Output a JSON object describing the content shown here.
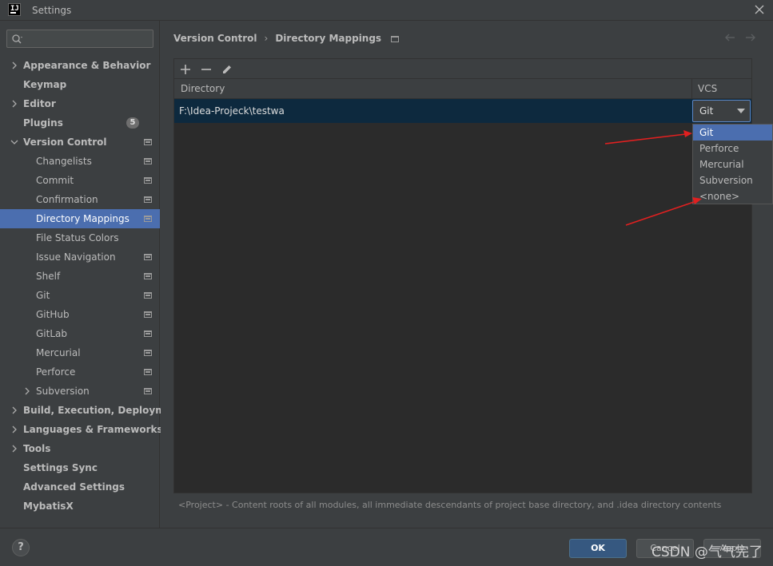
{
  "window": {
    "title": "Settings"
  },
  "search": {
    "placeholder": ""
  },
  "sidebar": {
    "items": [
      {
        "label": "Appearance & Behavior",
        "level": 1,
        "bold": true,
        "chevron": "right"
      },
      {
        "label": "Keymap",
        "level": 1,
        "bold": true
      },
      {
        "label": "Editor",
        "level": 1,
        "bold": true,
        "chevron": "right"
      },
      {
        "label": "Plugins",
        "level": 1,
        "bold": true,
        "badge": "5"
      },
      {
        "label": "Version Control",
        "level": 1,
        "bold": true,
        "chevron": "down",
        "project_icon": true
      },
      {
        "label": "Changelists",
        "level": 2,
        "project_icon": true
      },
      {
        "label": "Commit",
        "level": 2,
        "project_icon": true
      },
      {
        "label": "Confirmation",
        "level": 2,
        "project_icon": true
      },
      {
        "label": "Directory Mappings",
        "level": 2,
        "project_icon": true,
        "selected": true
      },
      {
        "label": "File Status Colors",
        "level": 2
      },
      {
        "label": "Issue Navigation",
        "level": 2,
        "project_icon": true
      },
      {
        "label": "Shelf",
        "level": 2,
        "project_icon": true
      },
      {
        "label": "Git",
        "level": 2,
        "project_icon": true
      },
      {
        "label": "GitHub",
        "level": 2,
        "project_icon": true
      },
      {
        "label": "GitLab",
        "level": 2,
        "project_icon": true
      },
      {
        "label": "Mercurial",
        "level": 2,
        "project_icon": true
      },
      {
        "label": "Perforce",
        "level": 2,
        "project_icon": true
      },
      {
        "label": "Subversion",
        "level": 2,
        "chevron": "right",
        "project_icon": true
      },
      {
        "label": "Build, Execution, Deployment",
        "level": 1,
        "bold": true,
        "chevron": "right"
      },
      {
        "label": "Languages & Frameworks",
        "level": 1,
        "bold": true,
        "chevron": "right"
      },
      {
        "label": "Tools",
        "level": 1,
        "bold": true,
        "chevron": "right"
      },
      {
        "label": "Settings Sync",
        "level": 1,
        "bold": true
      },
      {
        "label": "Advanced Settings",
        "level": 1,
        "bold": true
      },
      {
        "label": "MybatisX",
        "level": 1,
        "bold": true
      }
    ]
  },
  "breadcrumb": {
    "parent": "Version Control",
    "current": "Directory Mappings"
  },
  "table": {
    "headers": {
      "directory": "Directory",
      "vcs": "VCS"
    },
    "rows": [
      {
        "directory": "F:\\Idea-Projeck\\testwa",
        "vcs": "Git"
      }
    ]
  },
  "dropdown": {
    "options": [
      "Git",
      "Perforce",
      "Mercurial",
      "Subversion",
      "<none>"
    ],
    "highlighted": "Git"
  },
  "footnote": "<Project> - Content roots of all modules, all immediate descendants of project base directory, and .idea directory contents",
  "buttons": {
    "help": "?",
    "ok": "OK",
    "cancel": "Cancel",
    "apply": "Apply"
  },
  "watermark": "CSDN @气气完了",
  "colors": {
    "selection": "#4b6eaf",
    "annotation_arrow": "#e02020"
  },
  "icons": {
    "toolbar": [
      "plus-icon",
      "minus-icon",
      "edit-icon"
    ],
    "nav": [
      "arrow-left-icon",
      "arrow-right-icon"
    ]
  }
}
